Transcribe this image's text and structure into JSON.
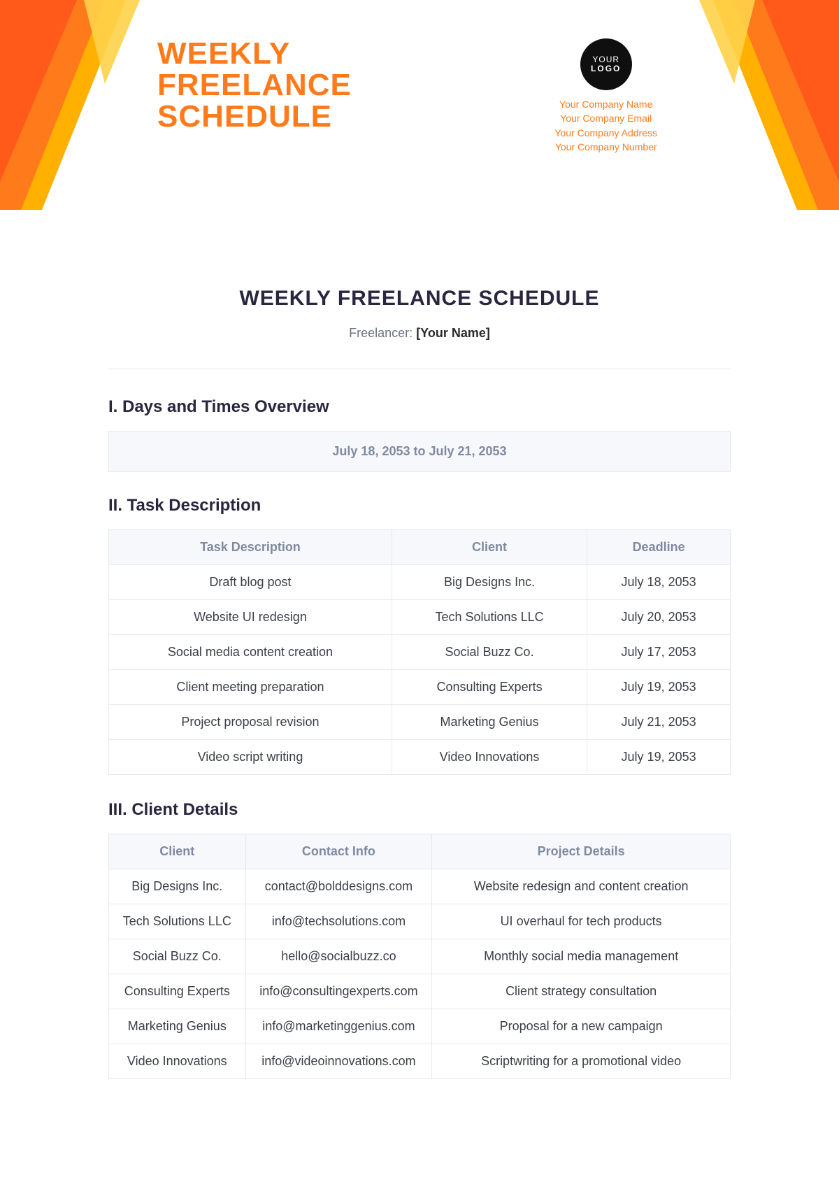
{
  "header": {
    "title_lines": [
      "WEEKLY",
      "FREELANCE",
      "SCHEDULE"
    ],
    "logo": {
      "line1": "YOUR",
      "line2": "LOGO"
    },
    "company_lines": [
      "Your Company Name",
      "Your Company Email",
      "Your Company Address",
      "Your Company Number"
    ]
  },
  "doc": {
    "title": "WEEKLY FREELANCE SCHEDULE",
    "freelancer_label": "Freelancer:",
    "freelancer_value": "[Your Name]"
  },
  "sections": {
    "overview_heading": "I. Days and Times Overview",
    "task_heading": "II. Task Description",
    "client_heading": "III. Client Details",
    "date_range": "July 18, 2053 to July 21, 2053"
  },
  "tasks": {
    "columns": [
      "Task Description",
      "Client",
      "Deadline"
    ],
    "rows": [
      [
        "Draft blog post",
        "Big Designs Inc.",
        "July 18, 2053"
      ],
      [
        "Website UI redesign",
        "Tech Solutions LLC",
        "July 20, 2053"
      ],
      [
        "Social media content creation",
        "Social Buzz Co.",
        "July 17, 2053"
      ],
      [
        "Client meeting preparation",
        "Consulting Experts",
        "July 19, 2053"
      ],
      [
        "Project proposal revision",
        "Marketing Genius",
        "July 21, 2053"
      ],
      [
        "Video script writing",
        "Video Innovations",
        "July 19, 2053"
      ]
    ]
  },
  "clients": {
    "columns": [
      "Client",
      "Contact Info",
      "Project Details"
    ],
    "rows": [
      [
        "Big Designs Inc.",
        "contact@bolddesigns.com",
        "Website redesign and content creation"
      ],
      [
        "Tech Solutions LLC",
        "info@techsolutions.com",
        "UI overhaul for tech products"
      ],
      [
        "Social Buzz Co.",
        "hello@socialbuzz.co",
        "Monthly social media management"
      ],
      [
        "Consulting Experts",
        "info@consultingexperts.com",
        "Client strategy consultation"
      ],
      [
        "Marketing Genius",
        "info@marketinggenius.com",
        "Proposal for a new campaign"
      ],
      [
        "Video Innovations",
        "info@videoinnovations.com",
        "Scriptwriting for a promotional video"
      ]
    ]
  }
}
